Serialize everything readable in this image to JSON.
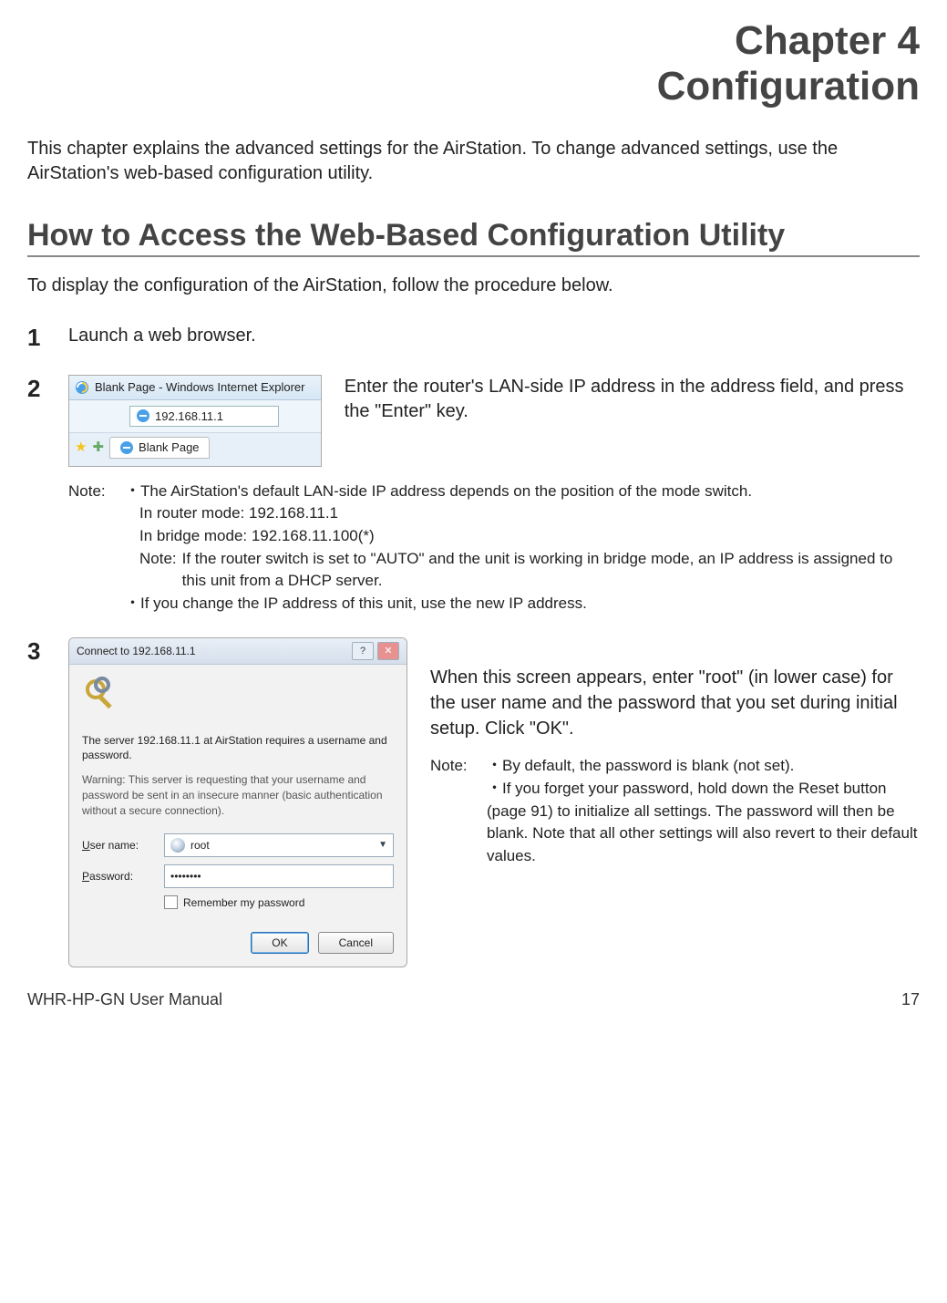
{
  "chapter": {
    "number": "Chapter 4",
    "title": "Configuration"
  },
  "intro": "This chapter explains the advanced settings for the AirStation. To change advanced settings, use the AirStation's web-based configuration utility.",
  "section": {
    "heading": "How to Access the Web-Based Configuration Utility",
    "intro": "To display the configuration of the AirStation, follow the procedure below."
  },
  "steps": {
    "s1": {
      "num": "1",
      "text": "Launch a web browser."
    },
    "s2": {
      "num": "2",
      "browser": {
        "title": "Blank Page - Windows Internet Explorer",
        "address": "192.168.11.1",
        "tab": "Blank Page"
      },
      "desc": "Enter the router's LAN-side IP address in the address field, and press the \"Enter\" key.",
      "note_label": "Note:",
      "note_b1": "・The AirStation's default LAN-side IP address depends on the position of the mode switch.",
      "note_router": "In router mode:  192.168.11.1",
      "note_bridge": "In bridge mode:  192.168.11.100(*)",
      "note_inner_label": "Note:",
      "note_inner": "If the router switch is set to \"AUTO\" and the unit is working in bridge mode, an IP address is assigned to this unit from a DHCP server.",
      "note_b2": "・If you change the IP address of this unit, use the new IP address."
    },
    "s3": {
      "num": "3",
      "dialog": {
        "title": "Connect to 192.168.11.1",
        "msg": "The server 192.168.11.1 at AirStation requires a username and password.",
        "warn": "Warning: This server is requesting that your username and password be sent in an insecure manner (basic authentication without a secure connection).",
        "user_label": "User name:",
        "user_value": "root",
        "pass_label": "Password:",
        "pass_value": "••••••••",
        "remember": "Remember my password",
        "ok": "OK",
        "cancel": "Cancel"
      },
      "desc1": "When this screen appears, enter \"root\" (in lower case) for the user name and the password that you set during initial setup. Click \"OK\".",
      "note_label": "Note:",
      "note_b1": "・By default, the password is blank (not set).",
      "note_b2": "・If you forget your password, hold down the  Reset button (page 91) to initialize all settings. The password will then be blank. Note that all other settings will also revert to their default values."
    }
  },
  "footer": {
    "left": "WHR-HP-GN User Manual",
    "right": "17"
  }
}
